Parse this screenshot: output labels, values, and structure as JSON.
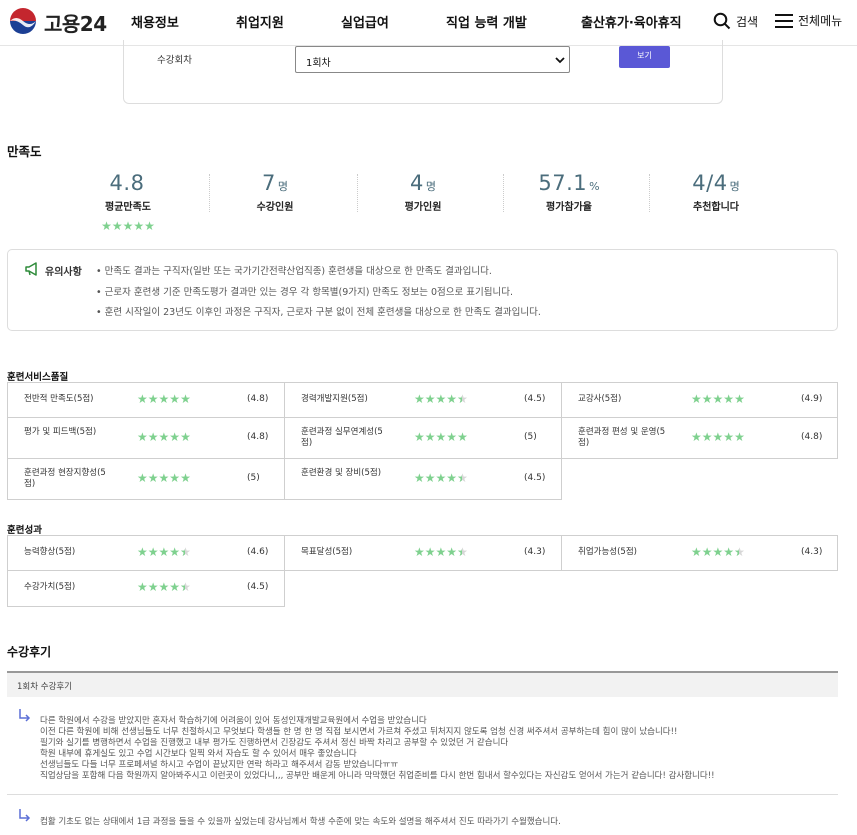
{
  "header": {
    "logo_text": "고용24",
    "nav": [
      "채용정보",
      "취업지원",
      "실업급여",
      "직업 능력 개발",
      "출산휴가·육아휴직"
    ],
    "search_label": "검색",
    "menu_label": "전체메뉴"
  },
  "course_select": {
    "label": "수강회차",
    "value": "1회차",
    "view_button": "보기"
  },
  "satisfaction": {
    "title": "만족도",
    "stats": [
      {
        "value": "4.8",
        "unit": "",
        "label": "평균만족도"
      },
      {
        "value": "7",
        "unit": "명",
        "label": "수강인원"
      },
      {
        "value": "4",
        "unit": "명",
        "label": "평가인원"
      },
      {
        "value": "57.1",
        "unit": "%",
        "label": "평가참가율"
      },
      {
        "value": "4/4",
        "unit": "명",
        "label": "추천합니다"
      }
    ],
    "average_rating": 4.8
  },
  "notice": {
    "title": "유의사항",
    "lines": [
      "• 만족도 결과는 구직자(일반 또는 국가기간전략산업직종) 훈련생을 대상으로 한 만족도 결과입니다.",
      "• 근로자 훈련생 기준 만족도평가 결과만 있는 경우 각 항목별(9가지) 만족도 정보는 0점으로 표기됩니다.",
      "• 훈련 시작일이 23년도 이후인 과정은 구직자, 근로자 구분 없이 전체 훈련생을 대상으로 한 만족도 결과입니다."
    ]
  },
  "service_quality": {
    "title": "훈련서비스품질",
    "items": [
      {
        "label": "전반적 만족도(5점)",
        "value": "(4.8)",
        "rating": 4.8
      },
      {
        "label": "경력개발지원(5점)",
        "value": "(4.5)",
        "rating": 4.5
      },
      {
        "label": "교강사(5점)",
        "value": "(4.9)",
        "rating": 4.9
      },
      {
        "label": "평가 및 피드백(5점)",
        "value": "(4.8)",
        "rating": 4.8
      },
      {
        "label": "훈련과정 실무연계성(5점)",
        "value": "(5)",
        "rating": 5
      },
      {
        "label": "훈련과정 편성 및 운영(5점)",
        "value": "(4.8)",
        "rating": 4.8
      },
      {
        "label": "훈련과정 현장지향성(5점)",
        "value": "(5)",
        "rating": 5
      },
      {
        "label": "훈련환경 및 장비(5점)",
        "value": "(4.5)",
        "rating": 4.5
      }
    ]
  },
  "outcomes": {
    "title": "훈련성과",
    "items": [
      {
        "label": "능력향상(5점)",
        "value": "(4.6)",
        "rating": 4.6
      },
      {
        "label": "목표달성(5점)",
        "value": "(4.3)",
        "rating": 4.3
      },
      {
        "label": "취업가능성(5점)",
        "value": "(4.3)",
        "rating": 4.3
      },
      {
        "label": "수강가치(5점)",
        "value": "(4.5)",
        "rating": 4.5
      }
    ]
  },
  "reviews": {
    "title": "수강후기",
    "round_label": "1회차 수강후기",
    "items": [
      {
        "lines": [
          "다른 학원에서 수강을 받았지만 혼자서 학습하기에 어려움이 있어 동성인재개발교육원에서 수업을 받았습니다",
          "이전 다른 학원에 비해 선생님들도 너무 친절하시고 무엇보다 학생들 한 명 한 명 직접 보시면서 가르쳐 주셨고 뒤처지지 않도록 엄청 신경 써주셔서 공부하는데 힘이 많이 났습니다!!",
          "필기와 실기를 병행하면서 수업을 진행했고 내부 평가도 진행하면서 긴장감도 주셔서 정신 바짝 차리고 공부할 수 있었던 거 같습니다",
          "학원 내부에 휴게실도 있고 수업 시간보다 일찍 와서 자습도 할 수 있어서 매우 좋았습니다",
          "선생님들도 다들 너무 프로페셔널 하시고 수업이 끝났지만 연락 하라고 해주셔서 감동 받았습니다ㅠㅠ",
          "직업상담을 포함해 다음 학원까지 알아봐주시고 이런곳이 있었다니,,, 공부만 배운게 아니라 막막했던 취업준비를 다시 한번 힘내서 할수있다는 자신감도 얻어서 가는거 같습니다! 감사합니다!!"
        ]
      },
      {
        "lines": [
          "컴활 기초도 없는 상태에서 1급 과정을 들을 수 있을까 싶었는데 강사님께서 학생 수준에 맞는 속도와 설명을 해주셔서 진도 따라가기 수월했습니다."
        ]
      }
    ]
  },
  "colors": {
    "accent_button": "#5a58d6",
    "star_on": "#7fd18f",
    "star_off": "#d7d7d7",
    "stat_number": "#4b6d7c",
    "notice_icon": "#2e8b3a",
    "review_arrow": "#5b6fd6"
  }
}
